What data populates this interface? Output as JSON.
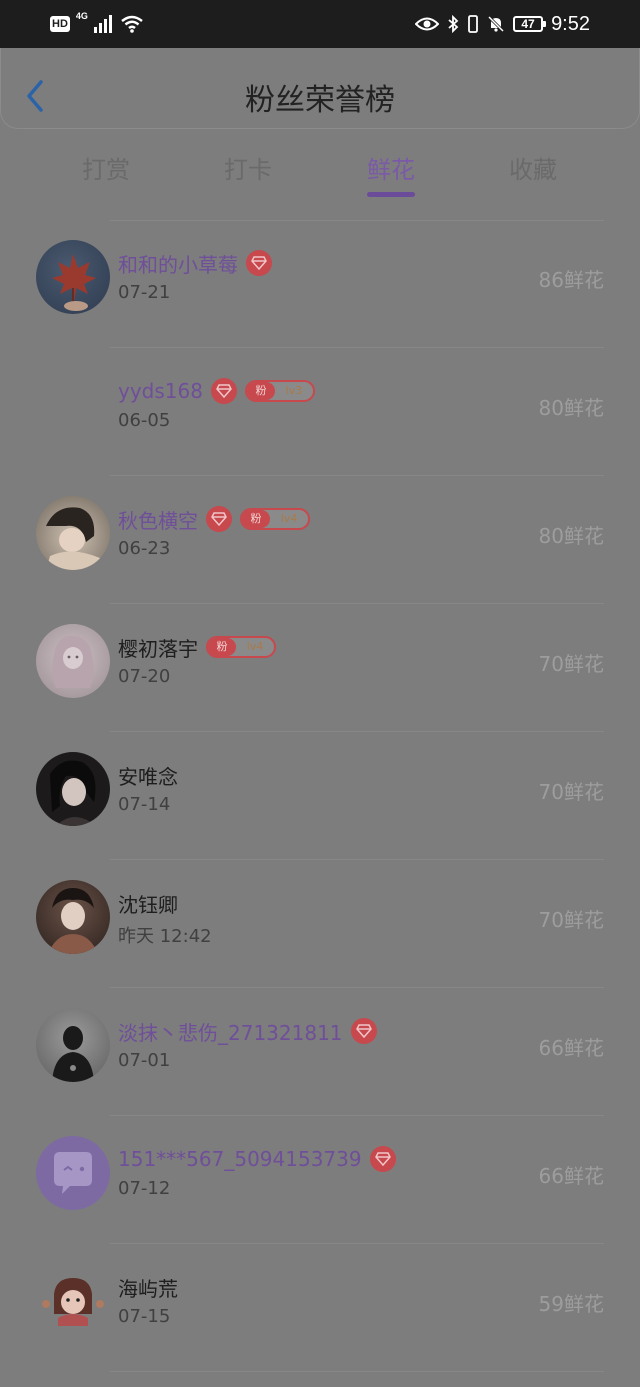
{
  "status_bar": {
    "hd": "HD",
    "network": "4G",
    "battery": "47",
    "time": "9:52"
  },
  "header": {
    "title": "粉丝荣誉榜"
  },
  "tabs": [
    {
      "label": "打赏",
      "active": false
    },
    {
      "label": "打卡",
      "active": false
    },
    {
      "label": "鲜花",
      "active": true
    },
    {
      "label": "收藏",
      "active": false
    }
  ],
  "rows": [
    {
      "name": "和和的小草莓",
      "date": "07-21",
      "flowers": "86鲜花",
      "vip": true,
      "fan_label": null,
      "level": null,
      "avatar": "maple-leaf"
    },
    {
      "name": "yyds168",
      "date": "06-05",
      "flowers": "80鲜花",
      "vip": true,
      "fan_label": "粉",
      "level": "lv3",
      "avatar": "none"
    },
    {
      "name": "秋色横空",
      "date": "06-23",
      "flowers": "80鲜花",
      "vip": true,
      "fan_label": "粉",
      "level": "lv4",
      "avatar": "girl-portrait"
    },
    {
      "name": "樱初落宇",
      "date": "07-20",
      "flowers": "70鲜花",
      "vip": false,
      "fan_label": "粉",
      "level": "lv4",
      "avatar": "sketch-girl"
    },
    {
      "name": "安唯念",
      "date": "07-14",
      "flowers": "70鲜花",
      "vip": false,
      "fan_label": null,
      "level": null,
      "avatar": "dark-portrait"
    },
    {
      "name": "沈钰卿",
      "date": "昨天 12:42",
      "flowers": "70鲜花",
      "vip": false,
      "fan_label": null,
      "level": null,
      "avatar": "hanfu-portrait"
    },
    {
      "name": "淡抹丶悲伤_271321811",
      "date": "07-01",
      "flowers": "66鲜花",
      "vip": true,
      "fan_label": null,
      "level": null,
      "avatar": "silhouette"
    },
    {
      "name": "151***567_5094153739",
      "date": "07-12",
      "flowers": "66鲜花",
      "vip": true,
      "fan_label": null,
      "level": null,
      "avatar": "chat-bubble"
    },
    {
      "name": "海屿荒",
      "date": "07-15",
      "flowers": "59鲜花",
      "vip": false,
      "fan_label": null,
      "level": null,
      "avatar": "cartoon-girl"
    }
  ],
  "colors": {
    "accent": "#6b4c9a",
    "vip_name": "#6f4f9a",
    "badge_red": "#c7484d",
    "back_arrow": "#2a63a8",
    "overlay_bg": "#7d7d7d"
  }
}
